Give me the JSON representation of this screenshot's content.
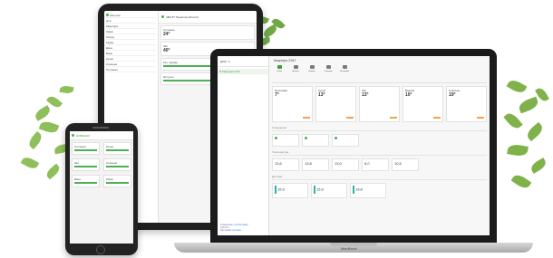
{
  "tablet": {
    "header_title": "АВК 87 Проветка (Россия)",
    "side_user": "ulan.ivan",
    "side_rows": [
      "Дом",
      "Квартира",
      "Офис",
      "Склад",
      "Гараж",
      "Дача",
      "Баня",
      "Кухня",
      "Спальня",
      "Гостиная"
    ],
    "card1_title": "Гостиная",
    "card1_value": "24°",
    "card2_title": "Зал",
    "card2_value": "40°",
    "card3_title": "Газ, газами",
    "card4_title": "Ж/ пульт"
  },
  "laptop": {
    "side_header": "ДОМ",
    "side_item": "Я Квартира 2Э Р",
    "page_title": "Квартира 2Э4Т",
    "tabs": [
      "Обзор",
      "Датчики",
      "Камеры",
      "Сценарии",
      "Настройки"
    ],
    "rooms": [
      {
        "name": "Прихожая",
        "value": "7°"
      },
      {
        "name": "Кухня",
        "value": "13°"
      },
      {
        "name": "Зал",
        "value": "13°"
      },
      {
        "name": "Ванная",
        "value": "10°"
      },
      {
        "name": "Спальня",
        "value": "19°"
      }
    ],
    "section1": "Освещение",
    "section2": "Температура",
    "temps": [
      "13,6",
      "13,8",
      "13,0",
      "6,0",
      "10,6"
    ],
    "section3": "Датчики",
    "sensors": [
      "15,9",
      "15,9",
      "13,8"
    ],
    "link1": "Управление устройствами",
    "link2": "Удалить",
    "link3": "Настройки системы",
    "brand": "MacBook"
  },
  "phone": {
    "title": "НОВИНКИ",
    "cards": [
      "Гостиная",
      "Кухня",
      "Зал",
      "Спальня",
      "Баня",
      "Офис"
    ]
  }
}
